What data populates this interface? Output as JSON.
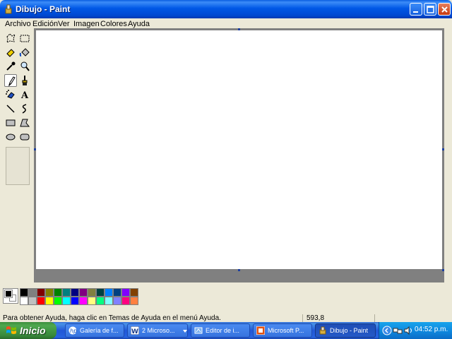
{
  "window": {
    "title": "Dibujo - Paint"
  },
  "menu": [
    "Archivo",
    "Edición",
    "Ver",
    "Imagen",
    "Colores",
    "Ayuda"
  ],
  "tools": [
    "free-form-select-icon",
    "select-icon",
    "eraser-icon",
    "fill-icon",
    "color-picker-icon",
    "magnifier-icon",
    "pencil-icon",
    "brush-icon",
    "airbrush-icon",
    "text-icon",
    "line-icon",
    "curve-icon",
    "rectangle-icon",
    "polygon-icon",
    "ellipse-icon",
    "rounded-rectangle-icon"
  ],
  "selected_tool": "pencil-icon",
  "palette": {
    "foreground": "#000000",
    "background": "#FFFFFF",
    "row1": [
      "#000000",
      "#808080",
      "#800000",
      "#808000",
      "#008000",
      "#008080",
      "#000080",
      "#800080",
      "#808040",
      "#004040",
      "#0080FF",
      "#004080",
      "#8000FF",
      "#804000"
    ],
    "row2": [
      "#FFFFFF",
      "#C0C0C0",
      "#FF0000",
      "#FFFF00",
      "#00FF00",
      "#00FFFF",
      "#0000FF",
      "#FF00FF",
      "#FFFF80",
      "#00FF80",
      "#80FFFF",
      "#8080FF",
      "#FF0080",
      "#FF8040"
    ]
  },
  "status": {
    "help": "Para obtener Ayuda, haga clic en Temas de Ayuda en el menú Ayuda.",
    "coords": "593,8"
  },
  "taskbar": {
    "start": "Inicio",
    "tasks": [
      "Galería de f...",
      "2 Microso...",
      "Editor de i...",
      "Microsoft P...",
      "Dibujo - Paint"
    ],
    "active_task": "Dibujo - Paint",
    "time": "04:52 p.m."
  }
}
